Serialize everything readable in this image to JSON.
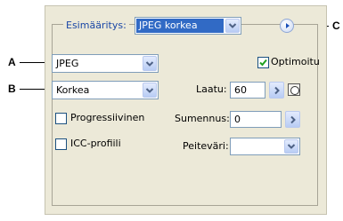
{
  "callouts": {
    "a": "A",
    "b": "B",
    "c": "C"
  },
  "preset": {
    "label": "Esimääritys:",
    "value": "JPEG korkea"
  },
  "format": {
    "value": "JPEG"
  },
  "quality_preset": {
    "value": "Korkea"
  },
  "optimized": {
    "label": "Optimoitu",
    "checked": true
  },
  "quality": {
    "label": "Laatu:",
    "value": "60"
  },
  "progressive": {
    "label": "Progressiivinen",
    "checked": false
  },
  "blur": {
    "label": "Sumennus:",
    "value": "0"
  },
  "icc": {
    "label": "ICC-profiili",
    "checked": false
  },
  "matte": {
    "label": "Peiteväri:",
    "value": ""
  },
  "icons": {
    "menu": "circle-arrow-icon",
    "dropdown": "chevron-down-icon",
    "stepper": "chevron-right-icon",
    "eyedropper": "eyedropper-icon"
  },
  "colors": {
    "accent": "#316ac5",
    "check": "#21a121",
    "panel": "#ece9d8"
  }
}
